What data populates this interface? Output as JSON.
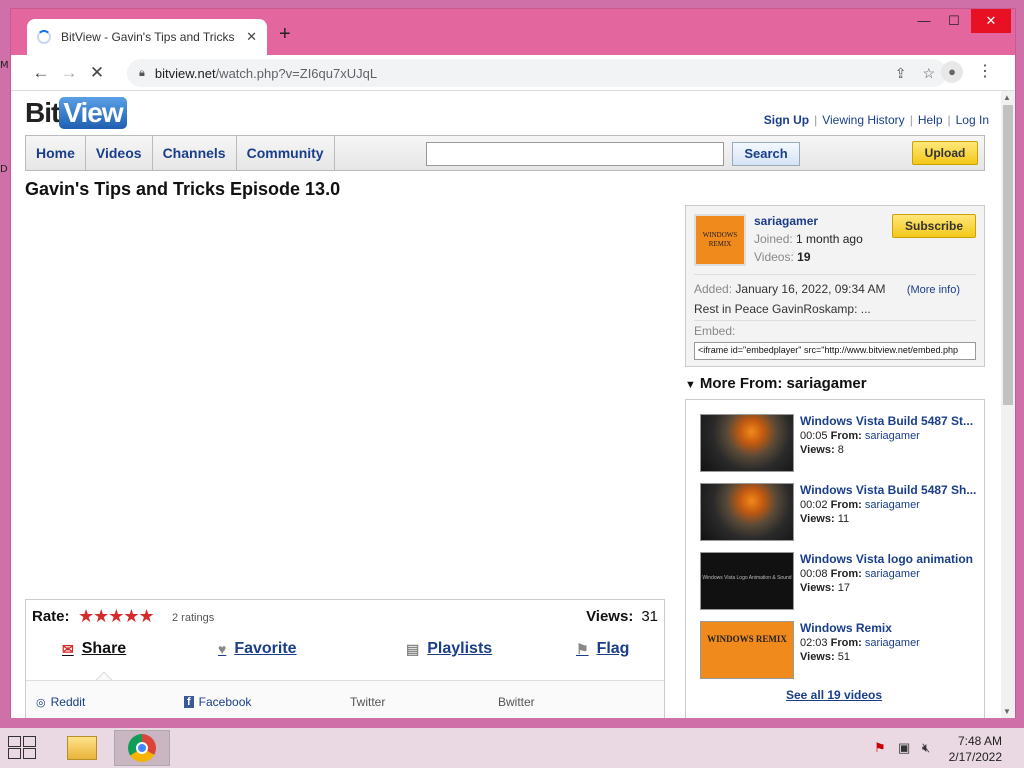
{
  "browser": {
    "tab_title": "BitView - Gavin's Tips and Tricks",
    "url_host": "bitview.net",
    "url_path": "/watch.php?v=ZI6qu7xUJqL"
  },
  "site": {
    "logo_bit": "Bit",
    "logo_view": "View",
    "toplinks": {
      "signup": "Sign Up",
      "history": "Viewing History",
      "help": "Help",
      "login": "Log In"
    },
    "nav": [
      "Home",
      "Videos",
      "Channels",
      "Community"
    ],
    "search_button": "Search",
    "search_value": "",
    "upload_button": "Upload"
  },
  "video": {
    "title": "Gavin's Tips and Tricks Episode 13.0",
    "rate_label": "Rate:",
    "stars": "★★★★★",
    "ratings": "2 ratings",
    "views_label": "Views:",
    "views": "31",
    "actions": {
      "share": "Share",
      "favorite": "Favorite",
      "playlists": "Playlists",
      "flag": "Flag"
    },
    "share_links": {
      "reddit": "Reddit",
      "facebook": "Facebook",
      "twitter": "Twitter",
      "bwitter": "Bwitter"
    }
  },
  "channel": {
    "name": "sariagamer",
    "thumb_text": "WINDOWS REMIX",
    "joined_label": "Joined:",
    "joined": "1 month ago",
    "videos_label": "Videos:",
    "videos": "19",
    "subscribe": "Subscribe",
    "added_label": "Added:",
    "added": "January 16, 2022, 09:34 AM",
    "more_info": "(More info)",
    "description": "Rest in Peace GavinRoskamp: ...",
    "embed_label": "Embed:",
    "embed_code": "<iframe id=\"embedplayer\" src=\"http://www.bitview.net/embed.php"
  },
  "more_from": {
    "heading": "More From: sariagamer",
    "from_label": "From:",
    "views_label": "Views:",
    "videos": [
      {
        "title": "Windows Vista Build 5487 St...",
        "duration": "00:05",
        "user": "sariagamer",
        "views": "8"
      },
      {
        "title": "Windows Vista Build 5487 Sh...",
        "duration": "00:02",
        "user": "sariagamer",
        "views": "11"
      },
      {
        "title": "Windows Vista logo animation",
        "duration": "00:08",
        "user": "sariagamer",
        "views": "17"
      },
      {
        "title": "Windows Remix",
        "duration": "02:03",
        "user": "sariagamer",
        "views": "51"
      }
    ],
    "see_all": "See all 19 videos",
    "thumb3_text": "Windows Vista Logo Animation & Sound",
    "thumb4_text": "WINDOWS REMIX"
  },
  "taskbar": {
    "time": "7:48 AM",
    "date": "2/17/2022"
  }
}
